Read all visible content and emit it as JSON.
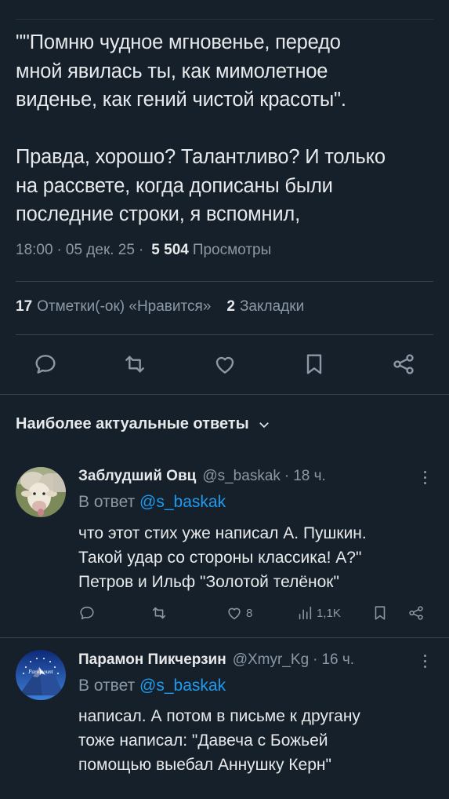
{
  "tweet": {
    "text": "\"\"Помню чудное мгновенье, передо\nмной явилась ты, как мимолетное\nвиденье, как гений чистой красоты\".\n\nПравда, хорошо? Талантливо? И только\nна рассвете, когда дописаны были\nпоследние строки, я вспомнил,",
    "time": "18:00",
    "date": "05 дек. 25",
    "views_count": "5 504",
    "views_label": "Просмотры",
    "likes_count": "17",
    "likes_label": "Отметки(-ок) «Нравится»",
    "bookmarks_count": "2",
    "bookmarks_label": "Закладки"
  },
  "actions": [
    "reply-icon",
    "retweet-icon",
    "like-icon",
    "bookmark-icon",
    "share-icon"
  ],
  "replies_section": {
    "title": "Наиболее актуальные ответы"
  },
  "replies": [
    {
      "name": "Заблудший Овц",
      "handle": "@s_baskak",
      "time": "18 ч.",
      "reply_prefix": "В ответ",
      "reply_to": "@s_baskak",
      "text": "что этот стих уже написал А. Пушкин.\nТакой удар со стороны классика! А?\"\nПетров и Ильф \"Золотой телёнок\"",
      "likes": "8",
      "views": "1,1K"
    },
    {
      "name": "Парамон Пикчерзин",
      "handle": "@Xmyr_Kg",
      "time": "16 ч.",
      "reply_prefix": "В ответ",
      "reply_to": "@s_baskak",
      "text": "написал. А потом в письме к другану\nтоже написал: \"Давеча с Божьей\nпомощью выебал Аннушку Керн\"",
      "avatar_text": "Paramount"
    }
  ],
  "colors": {
    "background": "#15202b",
    "text": "#e7e9ea",
    "secondary": "#8b98a5",
    "link": "#1d9bf0",
    "divider": "#38444d"
  }
}
